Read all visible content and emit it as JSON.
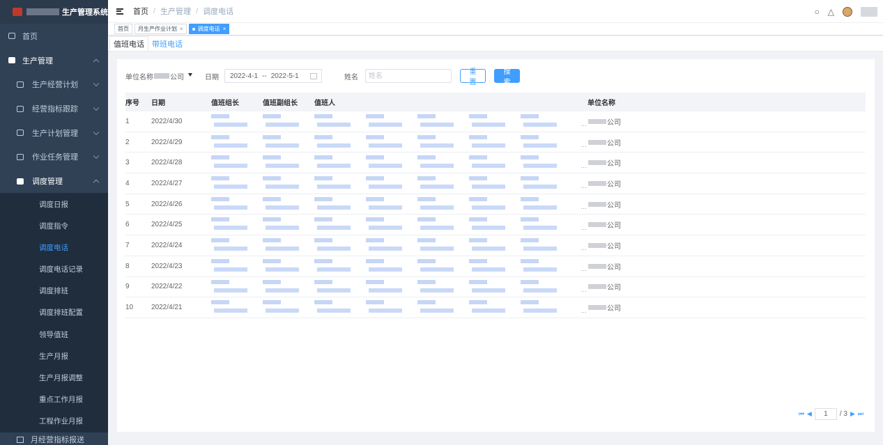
{
  "app": {
    "title": "生产管理系统"
  },
  "sidebar": {
    "home": "首页",
    "groups": [
      {
        "label": "生产管理",
        "expanded": true
      }
    ],
    "sections": [
      {
        "label": "生产经营计划"
      },
      {
        "label": "经营指标跟踪"
      },
      {
        "label": "生产计划管理"
      },
      {
        "label": "作业任务管理"
      }
    ],
    "dispatch": {
      "label": "调度管理",
      "items": [
        {
          "label": "调度日报"
        },
        {
          "label": "调度指令"
        },
        {
          "label": "调度电话",
          "active": true
        },
        {
          "label": "调度电话记录"
        },
        {
          "label": "调度排班"
        },
        {
          "label": "调度排班配置"
        },
        {
          "label": "领导值班"
        },
        {
          "label": "生产月报"
        },
        {
          "label": "生产月报调整"
        },
        {
          "label": "重点工作月报"
        },
        {
          "label": "工程作业月报"
        }
      ]
    },
    "bottom": "月经营指标报送"
  },
  "navbar": {
    "breadcrumb": [
      "首页",
      "生产管理",
      "调度电话"
    ]
  },
  "tags": [
    {
      "label": "首页"
    },
    {
      "label": "月生产作业计划"
    },
    {
      "label": "调度电话",
      "active": true
    }
  ],
  "subtabs": [
    {
      "label": "值班电话",
      "active": true
    },
    {
      "label": "带班电话"
    }
  ],
  "filters": {
    "unit_label": "单位名称",
    "unit_prefix": "单位名称",
    "unit_suffix": "公司",
    "date_label": "日期",
    "date_start": "2022-4-1",
    "date_sep": "--",
    "date_end": "2022-5-1",
    "name_label": "姓名",
    "name_placeholder": "姓名",
    "reset": "重置",
    "search": "搜索"
  },
  "table": {
    "columns": [
      "序号",
      "日期",
      "值班组长",
      "值班副组长",
      "值班人",
      "单位名称"
    ],
    "rows": [
      {
        "no": "1",
        "date": "2022/4/30",
        "unit": "公司"
      },
      {
        "no": "2",
        "date": "2022/4/29",
        "unit": "公司"
      },
      {
        "no": "3",
        "date": "2022/4/28",
        "unit": "公司"
      },
      {
        "no": "4",
        "date": "2022/4/27",
        "unit": "公司"
      },
      {
        "no": "5",
        "date": "2022/4/26",
        "unit": "公司"
      },
      {
        "no": "6",
        "date": "2022/4/25",
        "unit": "公司"
      },
      {
        "no": "7",
        "date": "2022/4/24",
        "unit": "公司"
      },
      {
        "no": "8",
        "date": "2022/4/23",
        "unit": "公司"
      },
      {
        "no": "9",
        "date": "2022/4/22",
        "unit": "公司"
      },
      {
        "no": "10",
        "date": "2022/4/21",
        "unit": "公司"
      }
    ]
  },
  "pager": {
    "current": "1",
    "total": "/ 3"
  },
  "colors": {
    "sidebar_bg": "#304156",
    "accent": "#409eff"
  }
}
